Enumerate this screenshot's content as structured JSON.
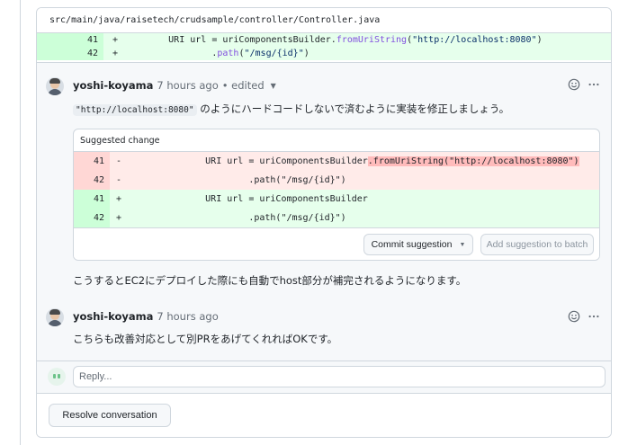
{
  "file": {
    "path": "src/main/java/raisetech/crudsample/controller/Controller.java",
    "lines": [
      {
        "num": "41",
        "sign": "+",
        "prefix": "        URI url = uriComponentsBuilder.",
        "fn": "fromUriString",
        "rest_open": "(",
        "str": "\"http://localhost:8080\"",
        "rest_close": ")"
      },
      {
        "num": "42",
        "sign": "+",
        "prefix": "                .",
        "fn": "path",
        "rest_open": "(",
        "str": "\"/msg/{id}\"",
        "rest_close": ")"
      }
    ]
  },
  "comment1": {
    "author": "yoshi-koyama",
    "time": "7 hours ago",
    "edited": "• edited",
    "code": "\"http://localhost:8080\"",
    "text": " のようにハードコードしないで済むように実装を修正しましょう。",
    "suggestion": {
      "title": "Suggested change",
      "rows": [
        {
          "type": "del",
          "num": "41",
          "sign": "-",
          "prefix": "        URI url = uriComponentsBuilder",
          "hl": ".fromUriString(\"http://localhost:8080\")",
          "suffix": ""
        },
        {
          "type": "del",
          "num": "42",
          "sign": "-",
          "prefix": "                .path(\"/msg/{id}\")",
          "hl": "",
          "suffix": ""
        },
        {
          "type": "add",
          "num": "41",
          "sign": "+",
          "prefix": "        URI url = uriComponentsBuilder",
          "hl": "",
          "suffix": ""
        },
        {
          "type": "add",
          "num": "42",
          "sign": "+",
          "prefix": "                .path(\"/msg/{id}\")",
          "hl": "",
          "suffix": ""
        }
      ],
      "commit_label": "Commit suggestion",
      "batch_label": "Add suggestion to batch"
    },
    "after_text": "こうするとEC2にデプロイした際にも自動でhost部分が補完されるようになります。"
  },
  "comment2": {
    "author": "yoshi-koyama",
    "time": "7 hours ago",
    "text": "こちらも改善対応として別PRをあげてくれればOKです。"
  },
  "reply": {
    "placeholder": "Reply..."
  },
  "resolve_label": "Resolve conversation",
  "icons": {
    "emoji": "smiley-icon",
    "more": "kebab-icon",
    "caret": "triangle-down-icon"
  },
  "colors": {
    "add_bg": "#e6ffec",
    "del_bg": "#ffebe9",
    "border": "#d0d7de"
  }
}
